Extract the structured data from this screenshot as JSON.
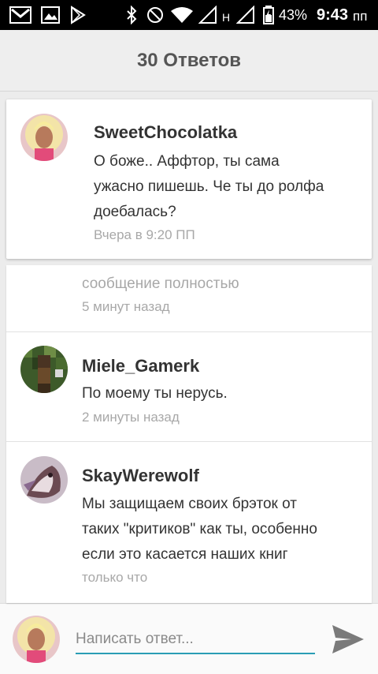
{
  "status_bar": {
    "network_label": "H",
    "battery": "43%",
    "time": "9:43",
    "ampm": "пп"
  },
  "header": {
    "title": "30 Ответов"
  },
  "pinned": {
    "username": "SweetChocolatka",
    "text_lines": [
      "О боже.. Аффтор, ты сама",
      "ужасно пишешь. Че ты до ролфа",
      "доебалась?"
    ],
    "time": "Вчера в 9:20 ПП"
  },
  "comments": [
    {
      "text_lines": [
        "сообщение полностью"
      ],
      "time": "5 минут назад"
    },
    {
      "username": "Miele_Gamerk",
      "text_lines": [
        "По моему ты нерусь."
      ],
      "time": "2 минуты назад"
    },
    {
      "username": "SkayWerewolf",
      "text_lines": [
        "Мы защищаем своих брэток от",
        "таких \"критиков\" как ты, особенно",
        "если это касается наших книг"
      ],
      "time": "только что"
    }
  ],
  "compose": {
    "placeholder": "Написать ответ..."
  },
  "colors": {
    "accent": "#2a9db5",
    "send_icon": "#7a7a7a",
    "muted_text": "#a8a8a8"
  }
}
